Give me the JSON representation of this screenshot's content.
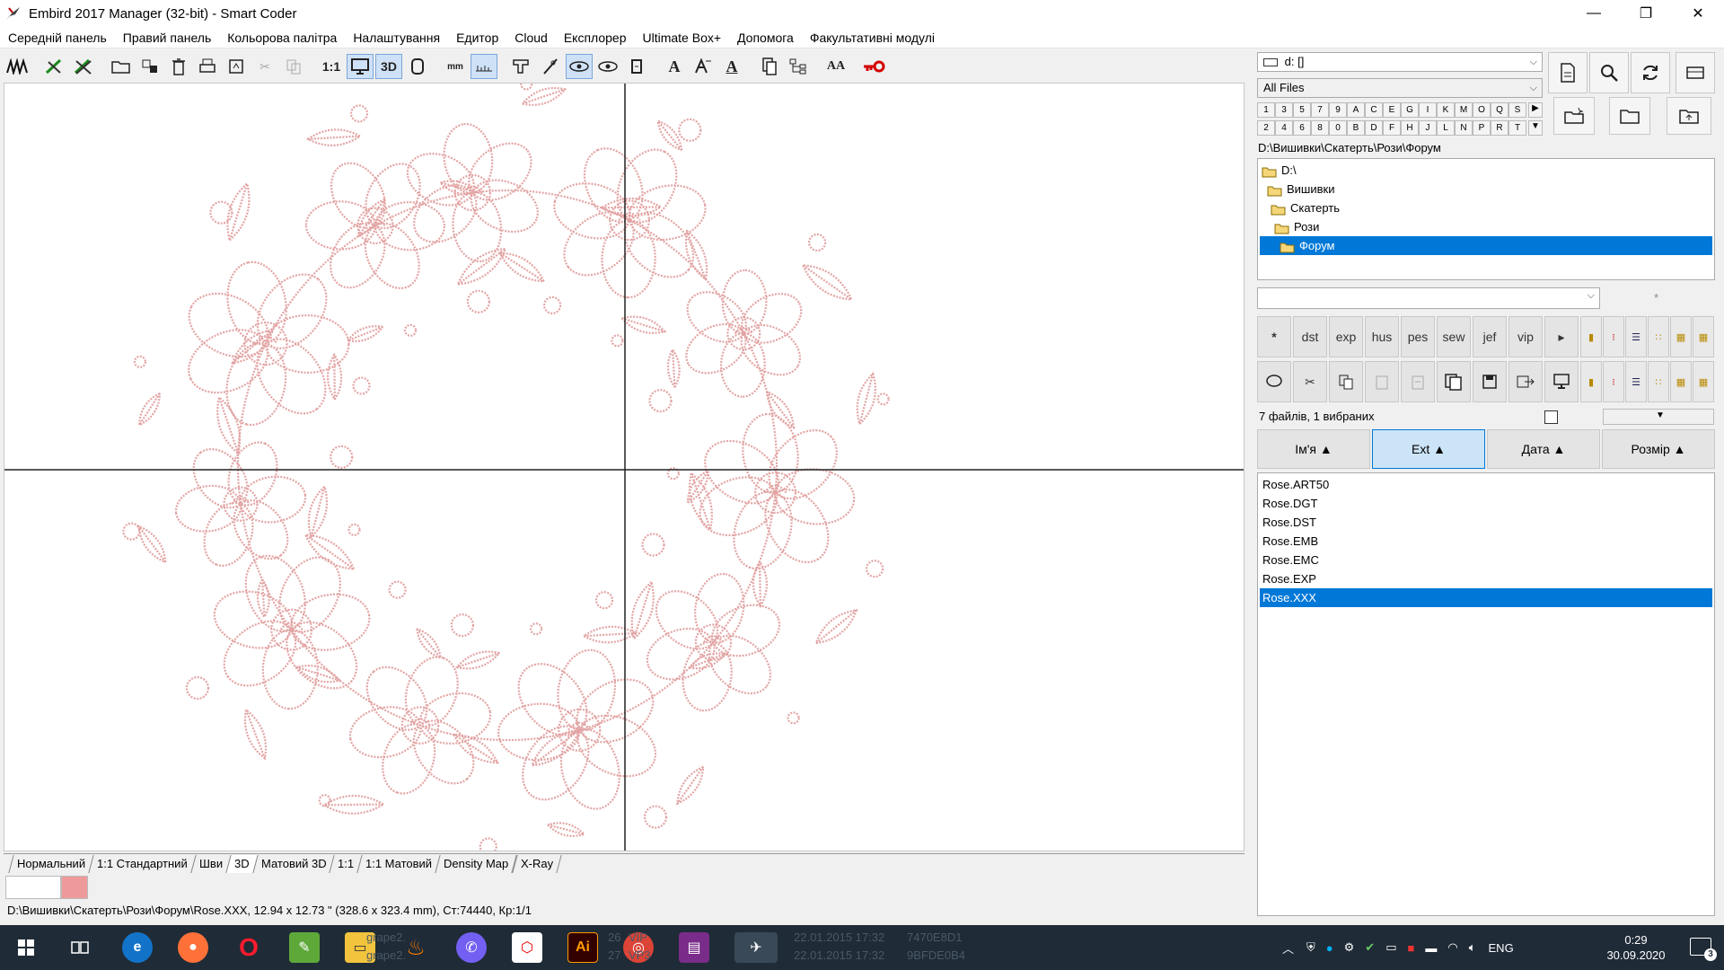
{
  "window": {
    "title": "Embird 2017 Manager (32-bit) - Smart Coder",
    "minimize": "—",
    "maximize": "❐",
    "close": "✕"
  },
  "menu": [
    "Середній панель",
    "Правий панель",
    "Кольорова палітра",
    "Налаштування",
    "Едитор",
    "Cloud",
    "Експлорер",
    "Ultimate Box+",
    "Допомога",
    "Факультативні модулі"
  ],
  "toolbar": {
    "scale_1_1": "1:1",
    "view_3d": "3D",
    "mm": "mm",
    "text_a": "A",
    "text_a2": "A",
    "aa": "AA"
  },
  "view_tabs": [
    "Нормальний",
    "1:1 Стандартний",
    "Шви",
    "3D",
    "Матовий 3D",
    "1:1",
    "1:1 Матовий",
    "Density Map",
    "X-Ray"
  ],
  "colors": {
    "background_swatch": "#ffffff",
    "thread_swatch": "#ee9a9a",
    "stitch": "#e3a4a4",
    "accent": "#0078d7"
  },
  "status": "D:\\Вишивки\\Скатерть\\Рози\\Форум\\Rose.XXX, 12.94 x 12.73 \" (328.6 x 323.4 mm), Ст:74440, Кр:1/1",
  "right_panel": {
    "drive": "d: []",
    "filter": "All Files",
    "letters_row1": [
      "1",
      "3",
      "5",
      "7",
      "9",
      "A",
      "C",
      "E",
      "G",
      "I",
      "K",
      "M",
      "O",
      "Q",
      "S"
    ],
    "letters_row2": [
      "2",
      "4",
      "6",
      "8",
      "0",
      "B",
      "D",
      "F",
      "H",
      "J",
      "L",
      "N",
      "P",
      "R",
      "T"
    ],
    "path": "D:\\Вишивки\\Скатерть\\Рози\\Форум",
    "tree": [
      "D:\\",
      "Вишивки",
      "Скатерть",
      "Рози",
      "Форум"
    ],
    "asterisk_hint": "*",
    "ext_buttons": [
      "*",
      "dst",
      "exp",
      "hus",
      "pes",
      "sew",
      "jef",
      "vip",
      "▸"
    ],
    "count": "7 файлів, 1 вибраних",
    "columns": [
      "Ім'я ▲",
      "Ext ▲",
      "Дата ▲",
      "Розмір ▲"
    ],
    "files": [
      "Rose.ART50",
      "Rose.DGT",
      "Rose.DST",
      "Rose.EMB",
      "Rose.EMC",
      "Rose.EXP",
      "Rose.XXX"
    ]
  },
  "taskbar": {
    "ghost_rows": [
      [
        "26",
        "VIP",
        "22.01.2015 17:32",
        "7470E8D1"
      ],
      [
        "27",
        "VP3",
        "22.01.2015 17:32",
        "9BFDE0B4"
      ]
    ],
    "ghost_names": [
      "grape2.",
      "grape2."
    ],
    "lang": "ENG",
    "time": "0:29",
    "date": "30.09.2020",
    "notifications": "3"
  }
}
